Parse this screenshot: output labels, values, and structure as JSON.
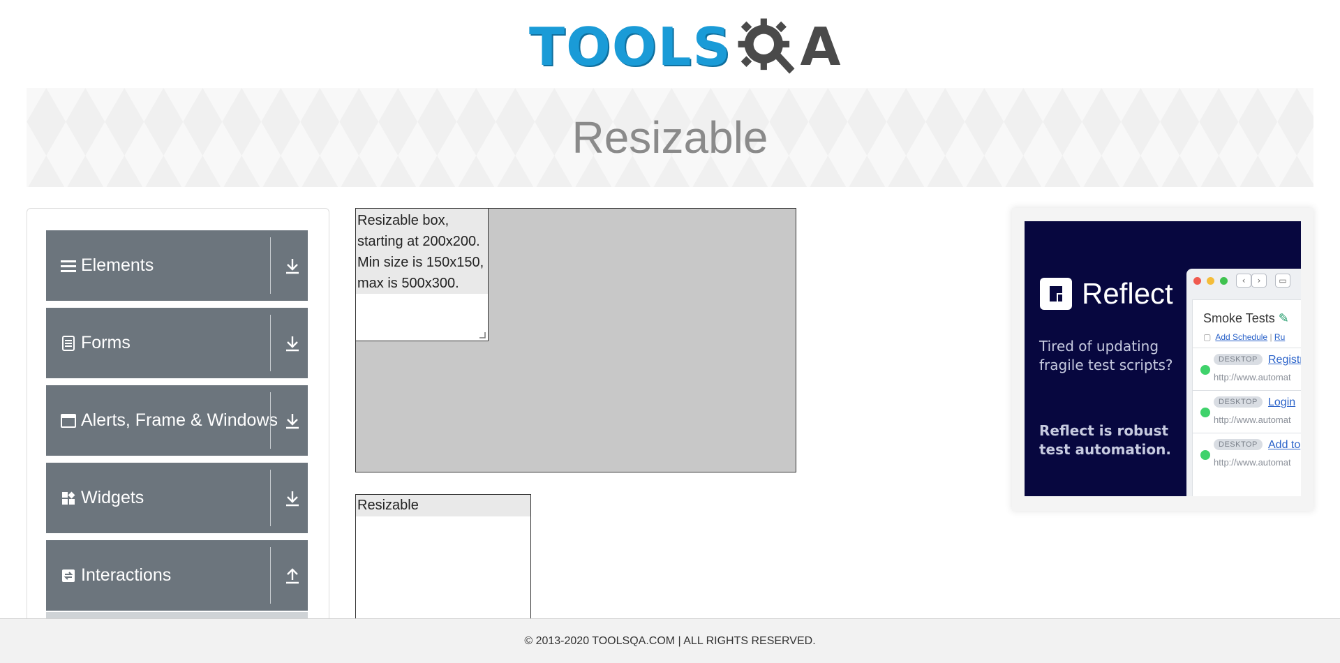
{
  "header": {
    "logo_text_left": "TOOLS",
    "logo_text_right": "A"
  },
  "banner": {
    "title": "Resizable"
  },
  "sidebar": {
    "groups": [
      {
        "label": "Elements",
        "icon": "menu-icon",
        "arrow": "download-arrow"
      },
      {
        "label": "Forms",
        "icon": "document-icon",
        "arrow": "download-arrow"
      },
      {
        "label": "Alerts, Frame & Windows",
        "icon": "window-icon",
        "arrow": "download-arrow"
      },
      {
        "label": "Widgets",
        "icon": "widgets-icon",
        "arrow": "download-arrow"
      },
      {
        "label": "Interactions",
        "icon": "interactions-icon",
        "arrow": "upload-arrow"
      }
    ]
  },
  "main": {
    "restricted_box_text": "Resizable box, starting at 200x200. Min size is 150x150, max is 500x300.",
    "free_box_text": "Resizable"
  },
  "ad": {
    "brand": "Reflect",
    "tagline": "Tired of updating fragile test scripts?",
    "pitch": "Reflect is robust test automation.",
    "panel_title": "Smoke Tests",
    "links": {
      "add_schedule": "Add Schedule",
      "separator": "|",
      "run": "Ru"
    },
    "rows": [
      {
        "badge": "DESKTOP",
        "name": "Registr",
        "url": "http://www.automat"
      },
      {
        "badge": "DESKTOP",
        "name": "Login",
        "url": "http://www.automat"
      },
      {
        "badge": "DESKTOP",
        "name": "Add to",
        "url": "http://www.automat"
      }
    ]
  },
  "footer": {
    "text": "© 2013-2020 TOOLSQA.COM | ALL RIGHTS RESERVED."
  },
  "colors": {
    "sidebar_group_bg": "#6c757d",
    "logo_blue": "#1a9bd7",
    "ad_bg": "#07073f",
    "constraint_bg": "#c8c8c8"
  }
}
